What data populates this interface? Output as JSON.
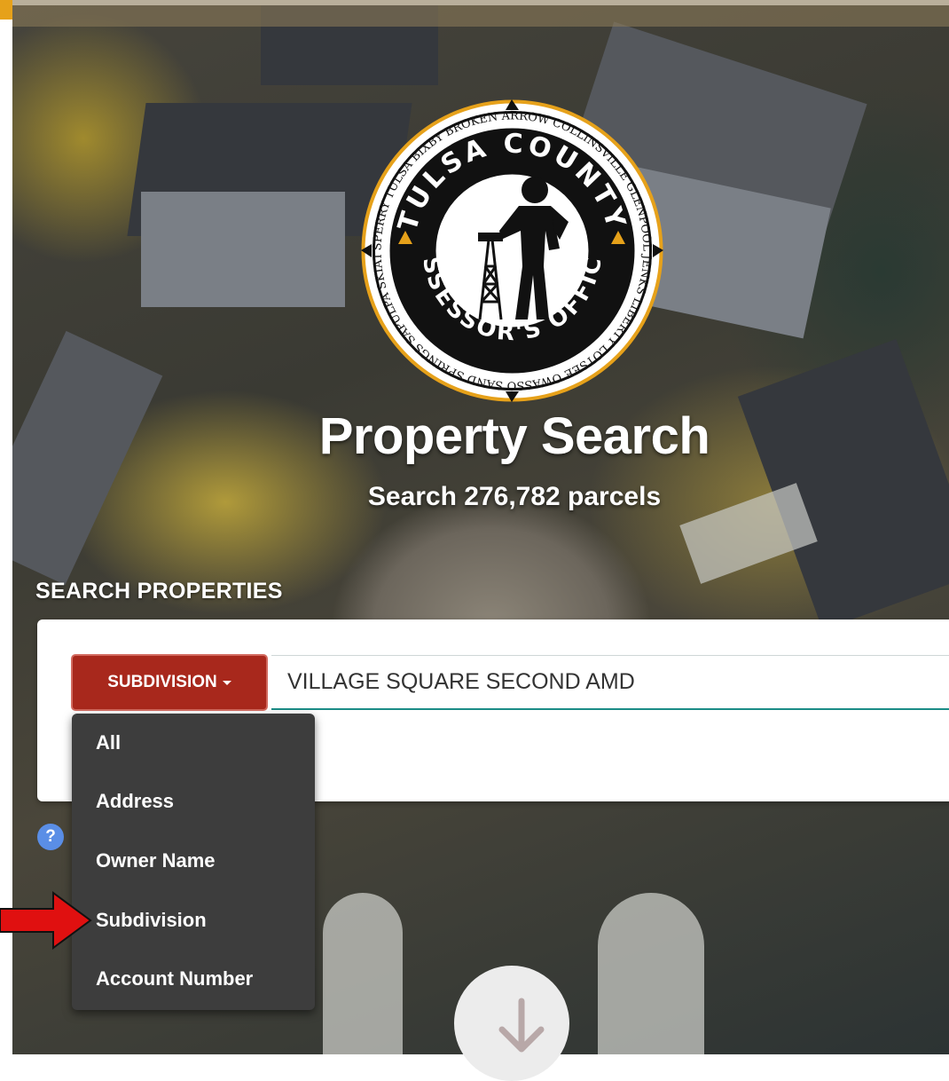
{
  "logo": {
    "top_text": "TULSA COUNTY",
    "bottom_text": "ASSESSOR'S OFFICE",
    "ring_text": "SPERRY TULSA BIXBY BROKEN ARROW COLLINSVILLE GLENPOOL JENKS LIBERTY LOTSEE OWASSO SAND SPRINGS SAPULPA SKIATOOK"
  },
  "hero": {
    "title": "Property Search",
    "subtitle": "Search 276,782 parcels"
  },
  "search": {
    "section_label": "SEARCH PROPERTIES",
    "type_button_label": "SUBDIVISION",
    "query_value": "VILLAGE SQUARE SECOND AMD",
    "type_options": [
      "All",
      "Address",
      "Owner Name",
      "Subdivision",
      "Account Number"
    ],
    "help_label": "?"
  },
  "colors": {
    "button_red": "#a8281c",
    "menu_bg": "#3d3d3d",
    "input_underline": "#1b8c86",
    "annotation_arrow": "#e01010",
    "help_blue": "#5a8ee6"
  },
  "icons": [
    "caret-down-icon",
    "help-icon",
    "annotation-arrow-icon",
    "scroll-down-icon"
  ]
}
